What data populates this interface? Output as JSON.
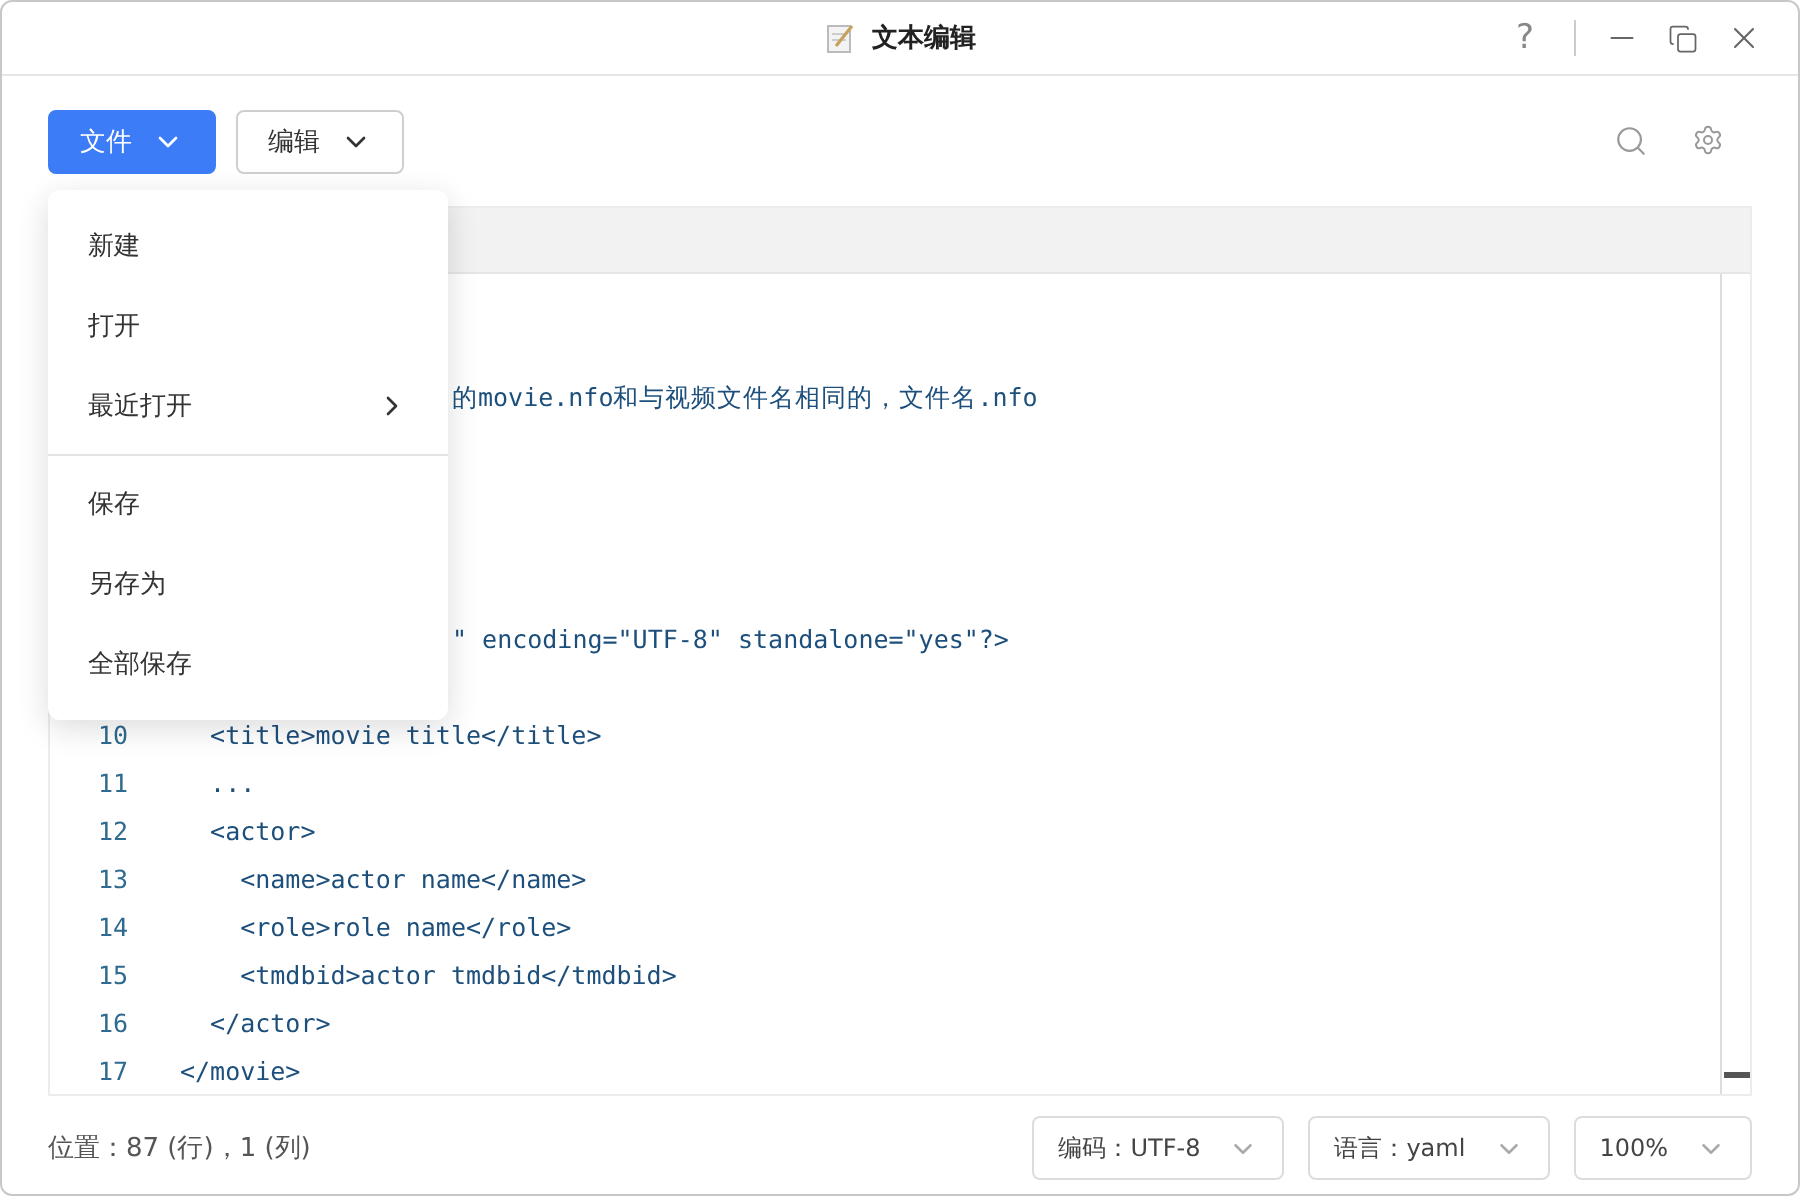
{
  "window": {
    "title": "文本编辑",
    "help": "?"
  },
  "toolbar": {
    "menus": [
      {
        "label": "文件",
        "selected": true
      },
      {
        "label": "编辑",
        "selected": false
      }
    ]
  },
  "file_menu": {
    "groups": [
      [
        {
          "label": "新建",
          "kind": "item"
        },
        {
          "label": "打开",
          "kind": "item"
        },
        {
          "label": "最近打开",
          "kind": "submenu"
        }
      ],
      [
        {
          "label": "保存",
          "kind": "item"
        },
        {
          "label": "另存为",
          "kind": "item"
        },
        {
          "label": "全部保存",
          "kind": "item"
        }
      ]
    ]
  },
  "editor": {
    "lines": [
      {
        "kind": "covered"
      },
      {
        "kind": "covered"
      },
      {
        "kind": "covered",
        "text": "的movie.nfo和与视频文件名相同的，文件名.nfo"
      },
      {
        "kind": "covered"
      },
      {
        "kind": "covered"
      },
      {
        "kind": "covered"
      },
      {
        "kind": "covered"
      },
      {
        "kind": "covered",
        "text": "\" encoding=\"UTF-8\" standalone=\"yes\"?>"
      },
      {
        "kind": "covered"
      },
      {
        "kind": "full",
        "number": "10",
        "text": "  <title>movie title</title>"
      },
      {
        "kind": "full",
        "number": "11",
        "text": "  ..."
      },
      {
        "kind": "full",
        "number": "12",
        "text": "  <actor>"
      },
      {
        "kind": "full",
        "number": "13",
        "text": "    <name>actor name</name>"
      },
      {
        "kind": "full",
        "number": "14",
        "text": "    <role>role name</role>"
      },
      {
        "kind": "full",
        "number": "15",
        "text": "    <tmdbid>actor tmdbid</tmdbid>"
      },
      {
        "kind": "full",
        "number": "16",
        "text": "  </actor>"
      },
      {
        "kind": "full",
        "number": "17",
        "text": "</movie>"
      }
    ]
  },
  "status_bar": {
    "position": "位置：87 (行)，1 (列)",
    "selects": [
      {
        "label": "编码：UTF-8"
      },
      {
        "label": "语言：yaml"
      },
      {
        "label": "100%"
      }
    ]
  }
}
